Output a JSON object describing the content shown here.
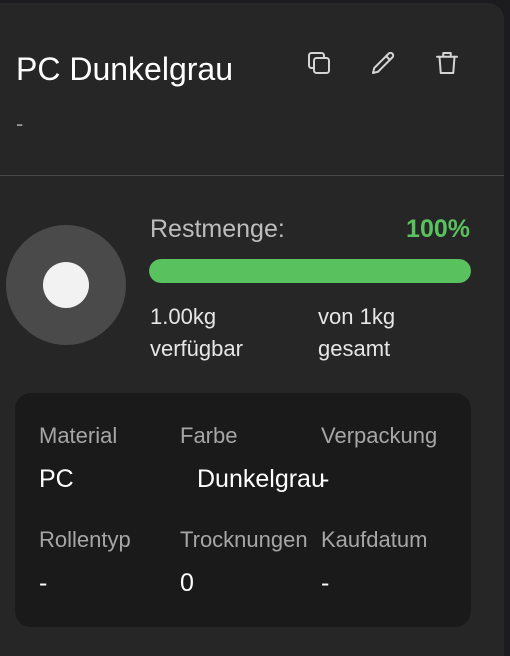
{
  "header": {
    "title": "PC Dunkelgrau",
    "subtitle": "-",
    "actions": {
      "duplicate_icon": "copy-icon",
      "edit_icon": "pencil-icon",
      "delete_icon": "trash-icon"
    }
  },
  "spool": {
    "color": "#4a4a4a",
    "icon": "spool-icon"
  },
  "remaining": {
    "label": "Restmenge:",
    "percent_text": "100%",
    "fraction": 1.0,
    "available_value": "1.00kg",
    "available_label": "verfügbar",
    "total_value": "von 1kg",
    "total_label": "gesamt"
  },
  "details": {
    "material": {
      "label": "Material",
      "value": "PC"
    },
    "color": {
      "label": "Farbe",
      "value": "Dunkelgrau"
    },
    "packaging": {
      "label": "Verpackung",
      "value": "-"
    },
    "spool_type": {
      "label": "Rollentyp",
      "value": "-"
    },
    "drying": {
      "label": "Trocknungen",
      "value": "0"
    },
    "purchase_date": {
      "label": "Kaufdatum",
      "value": "-"
    }
  },
  "colors": {
    "accent_green": "#5ac15f",
    "card_bg": "#262626",
    "details_bg": "#1a1a1a"
  }
}
